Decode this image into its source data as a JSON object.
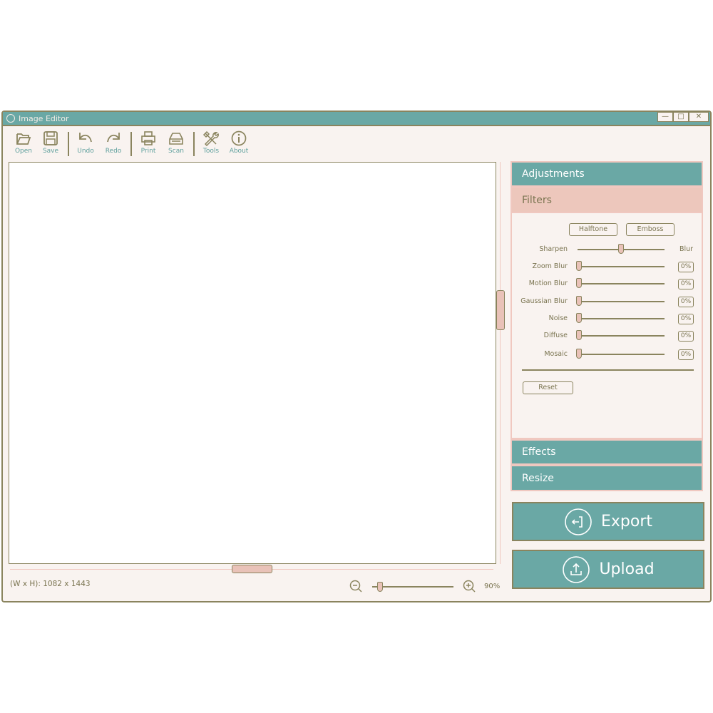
{
  "window": {
    "title": "Image Editor",
    "minimize": "—",
    "maximize": "□",
    "close": "✕"
  },
  "toolbar": [
    {
      "label": "Open",
      "icon": "folder-open-icon"
    },
    {
      "label": "Save",
      "icon": "floppy-disk-icon"
    },
    {
      "label": "Undo",
      "icon": "undo-icon"
    },
    {
      "label": "Redo",
      "icon": "redo-icon"
    },
    {
      "label": "Print",
      "icon": "printer-icon"
    },
    {
      "label": "Scan",
      "icon": "scanner-icon"
    },
    {
      "label": "Tools",
      "icon": "tools-icon"
    },
    {
      "label": "About",
      "icon": "info-icon"
    }
  ],
  "status": {
    "dimensions": "(W x H): 1082 x 1443",
    "zoom": "90%",
    "zoom_level": 0.1
  },
  "panel": {
    "sections": {
      "adjustments": "Adjustments",
      "filters": "Filters",
      "effects": "Effects",
      "resize": "Resize"
    },
    "filters": {
      "halftone": "Halftone",
      "emboss": "Emboss",
      "sharpen_label": "Sharpen",
      "blur_label": "Blur",
      "sharpen_blur_value": 0.5,
      "sliders": [
        {
          "label": "Zoom Blur",
          "value": "0%"
        },
        {
          "label": "Motion Blur",
          "value": "0%"
        },
        {
          "label": "Gaussian Blur",
          "value": "0%"
        },
        {
          "label": "Noise",
          "value": "0%"
        },
        {
          "label": "Diffuse",
          "value": "0%"
        },
        {
          "label": "Mosaic",
          "value": "0%"
        }
      ],
      "reset": "Reset"
    }
  },
  "actions": {
    "export": "Export",
    "upload": "Upload"
  },
  "colors": {
    "teal": "#6aa8a5",
    "pink": "#edc7bc",
    "border": "#8a845e",
    "background": "#f9f3f0"
  }
}
